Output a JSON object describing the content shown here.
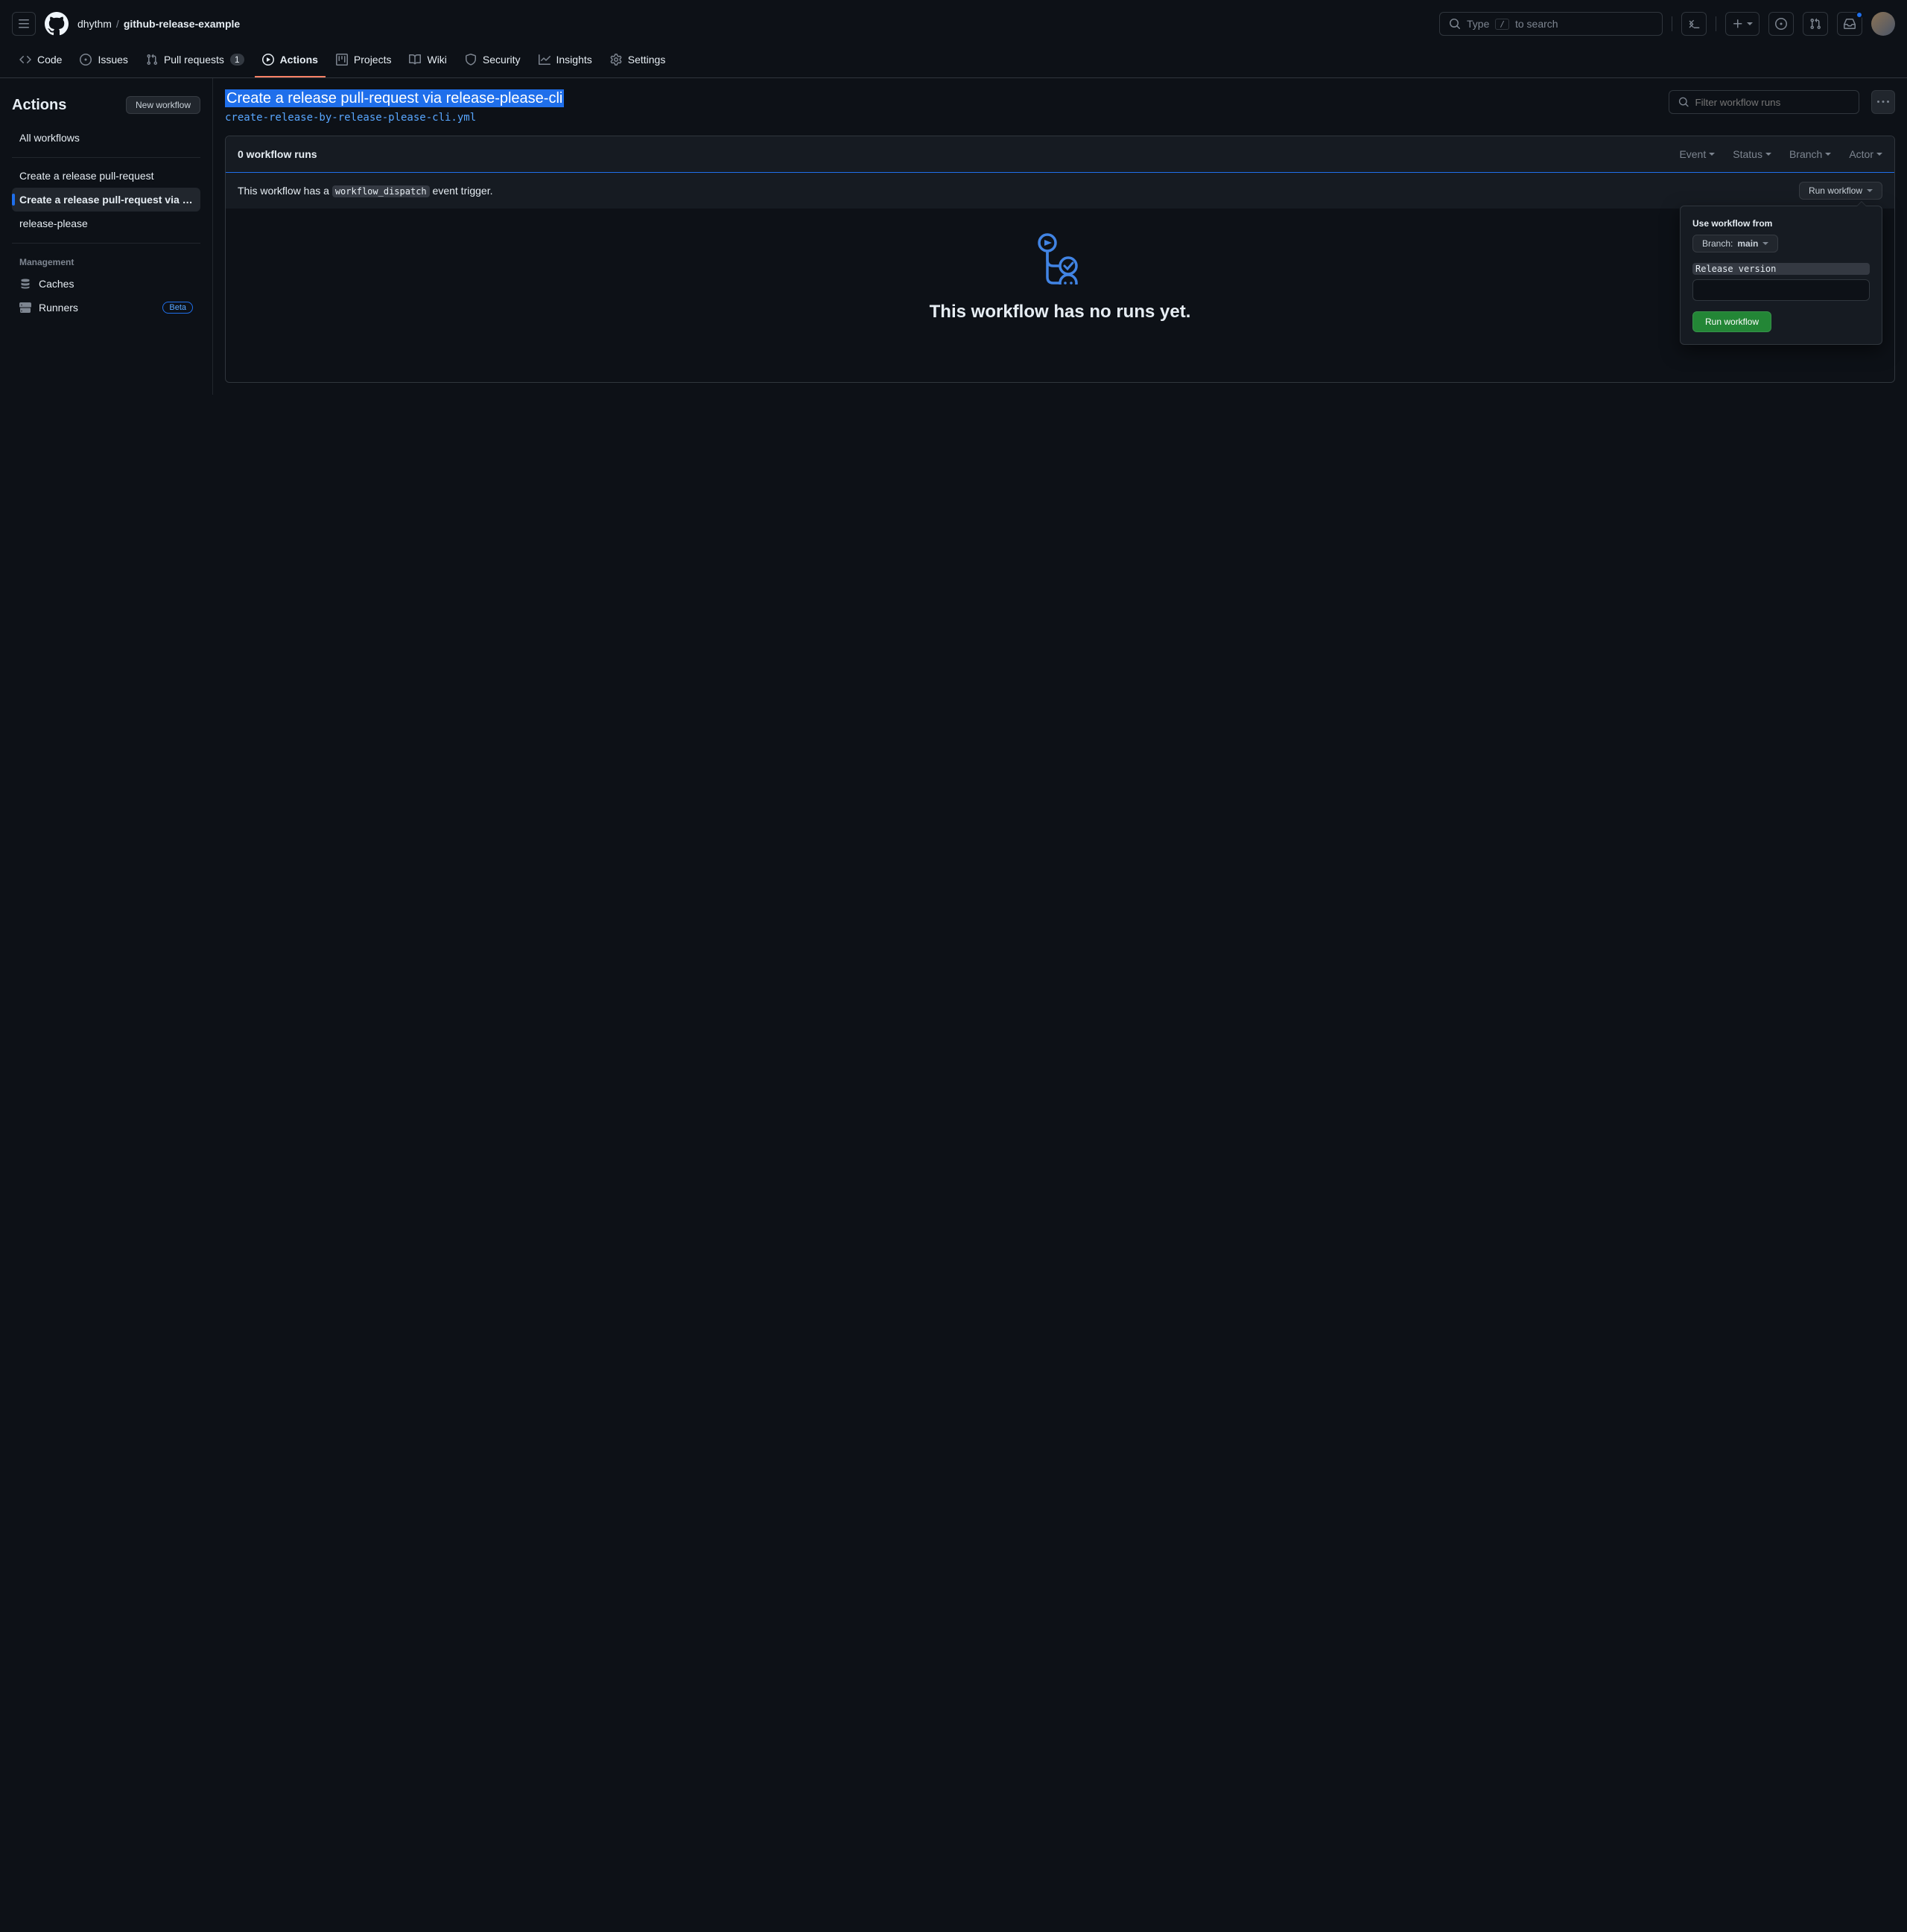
{
  "header": {
    "owner": "dhythm",
    "repo": "github-release-example",
    "search_prefix": "Type",
    "search_key": "/",
    "search_suffix": "to search"
  },
  "nav": {
    "code": "Code",
    "issues": "Issues",
    "pulls": "Pull requests",
    "pulls_count": "1",
    "actions": "Actions",
    "projects": "Projects",
    "wiki": "Wiki",
    "security": "Security",
    "insights": "Insights",
    "settings": "Settings"
  },
  "sidebar": {
    "title": "Actions",
    "new_workflow": "New workflow",
    "all_workflows": "All workflows",
    "workflows": [
      "Create a release pull-request",
      "Create a release pull-request via relea…",
      "release-please"
    ],
    "management": "Management",
    "caches": "Caches",
    "runners": "Runners",
    "beta": "Beta"
  },
  "content": {
    "title": "Create a release pull-request via release-please-cli",
    "file": "create-release-by-release-please-cli.yml",
    "filter_placeholder": "Filter workflow runs",
    "runs_count": "0 workflow runs",
    "filters": {
      "event": "Event",
      "status": "Status",
      "branch": "Branch",
      "actor": "Actor"
    },
    "dispatch_prefix": "This workflow has a ",
    "dispatch_code": "workflow_dispatch",
    "dispatch_suffix": " event trigger.",
    "run_workflow": "Run workflow",
    "empty_heading": "This workflow has no runs yet."
  },
  "dropdown": {
    "use_from": "Use workflow from",
    "branch_label": "Branch:",
    "branch_name": "main",
    "release_version": "Release version",
    "release_value": "",
    "submit": "Run workflow"
  }
}
